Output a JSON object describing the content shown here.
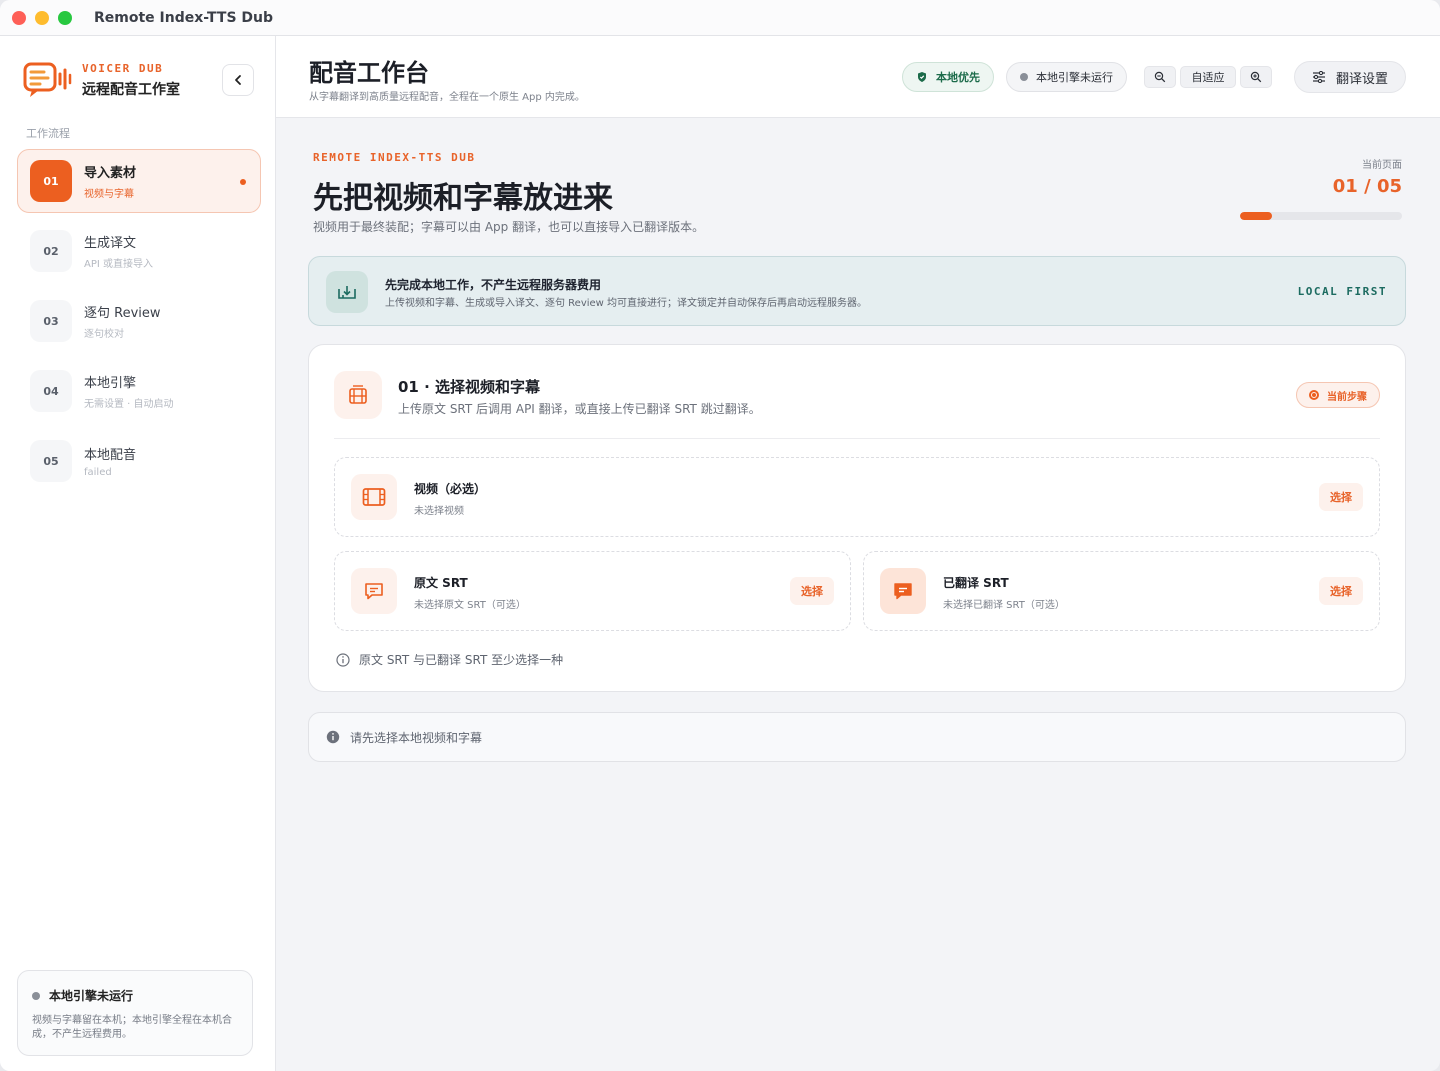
{
  "window": {
    "title": "Remote Index-TTS Dub"
  },
  "brand": {
    "en": "VOICER DUB",
    "cn": "远程配音工作室"
  },
  "sidebar": {
    "section_label": "工作流程",
    "steps": [
      {
        "num": "01",
        "title": "导入素材",
        "sub": "视频与字幕",
        "active": true
      },
      {
        "num": "02",
        "title": "生成译文",
        "sub": "API 或直接导入"
      },
      {
        "num": "03",
        "title": "逐句 Review",
        "sub": "逐句校对"
      },
      {
        "num": "04",
        "title": "本地引擎",
        "sub": "无需设置 · 自动启动"
      },
      {
        "num": "05",
        "title": "本地配音",
        "sub": "failed"
      }
    ],
    "engine_card": {
      "title": "本地引擎未运行",
      "desc": "视频与字幕留在本机；本地引擎全程在本机合成，不产生远程费用。"
    }
  },
  "header": {
    "title": "配音工作台",
    "subtitle": "从字幕翻译到高质量远程配音，全程在一个原生 App 内完成。",
    "local_first_label": "本地优先",
    "engine_status_label": "本地引擎未运行",
    "fit_label": "自适应",
    "settings_label": "翻译设置"
  },
  "hero": {
    "eyebrow": "REMOTE INDEX-TTS DUB",
    "title": "先把视频和字幕放进来",
    "subtitle": "视频用于最终装配；字幕可以由 App 翻译，也可以直接导入已翻译版本。",
    "progress_label": "当前页面",
    "progress_value": "01 / 05",
    "progress_fraction": 0.2
  },
  "notice": {
    "title": "先完成本地工作，不产生远程服务器费用",
    "desc": "上传视频和字幕、生成或导入译文、逐句 Review 均可直接进行；译文锁定并自动保存后再启动远程服务器。",
    "tag": "LOCAL FIRST"
  },
  "card": {
    "title": "01 · 选择视频和字幕",
    "subtitle": "上传原文 SRT 后调用 API 翻译，或直接上传已翻译 SRT 跳过翻译。",
    "badge": "当前步骤",
    "slots": {
      "video": {
        "title": "视频（必选）",
        "sub": "未选择视频",
        "button": "选择"
      },
      "source": {
        "title": "原文 SRT",
        "sub": "未选择原文 SRT（可选）",
        "button": "选择"
      },
      "translated": {
        "title": "已翻译 SRT",
        "sub": "未选择已翻译 SRT（可选）",
        "button": "选择"
      }
    },
    "hint": "原文 SRT 与已翻译 SRT 至少选择一种"
  },
  "status_bar": {
    "text": "请先选择本地视频和字幕"
  },
  "colors": {
    "accent": "#ec5f20",
    "teal": "#1c6b60",
    "muted": "#8a8f98"
  },
  "icons": [
    "chevron-left-icon",
    "shield-icon",
    "zoom-out-icon",
    "zoom-in-icon",
    "sliders-icon",
    "download-tray-icon",
    "film-icon",
    "subtitle-icon",
    "info-icon"
  ]
}
